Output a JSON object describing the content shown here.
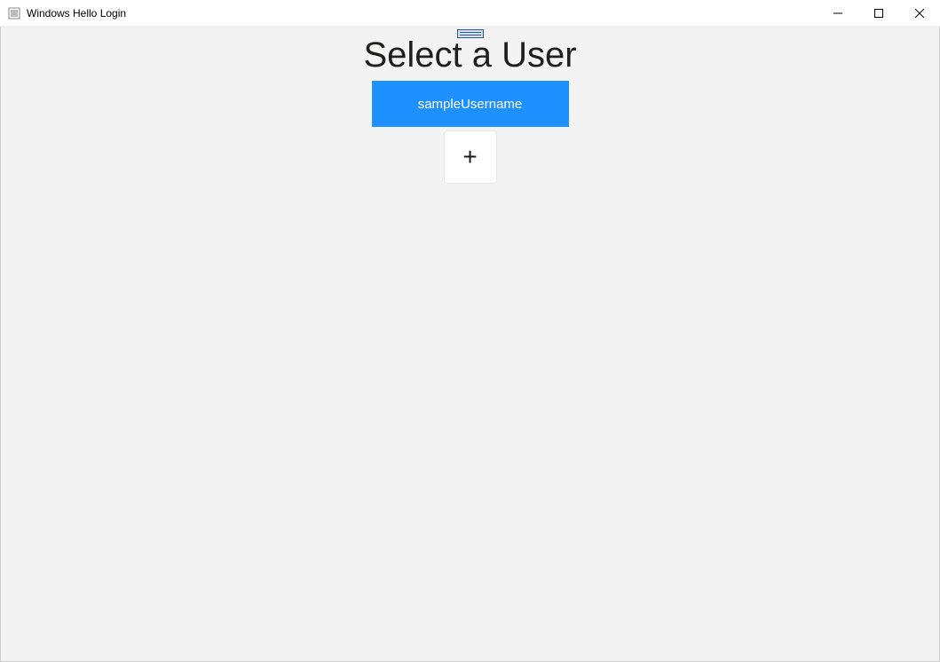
{
  "window": {
    "title": "Windows Hello Login"
  },
  "main": {
    "heading": "Select a User",
    "user_button_label": "sampleUsername",
    "add_button_glyph": "+"
  },
  "colors": {
    "accent": "#1e90ff",
    "client_bg": "#f3f3f3"
  }
}
